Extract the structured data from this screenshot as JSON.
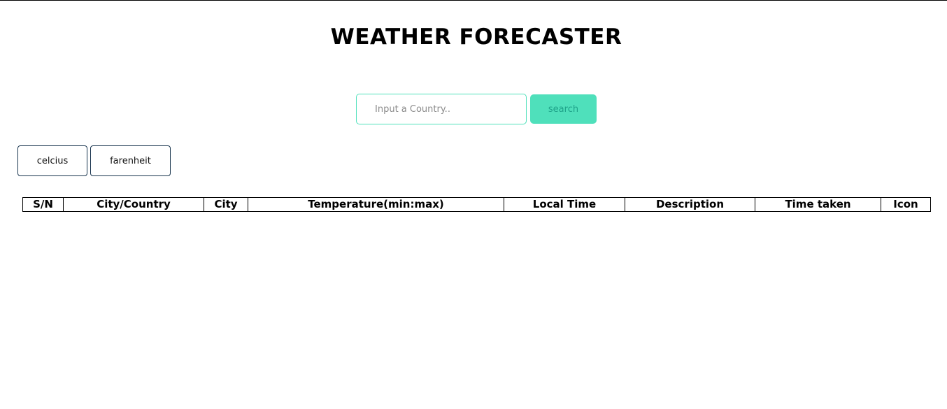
{
  "header": {
    "title": "WEATHER FORECASTER"
  },
  "search": {
    "placeholder": "Input a Country..",
    "value": "",
    "button_label": "search"
  },
  "units": {
    "celcius_label": "celcius",
    "farenheit_label": "farenheit"
  },
  "table": {
    "headers": [
      "S/N",
      "City/Country",
      "City",
      "Temperature(min:max)",
      "Local Time",
      "Description",
      "Time taken",
      "Icon"
    ],
    "rows": []
  },
  "colors": {
    "accent": "#4fe0bb",
    "accent_text": "#1fa38a",
    "unit_button_border": "#17334d"
  }
}
